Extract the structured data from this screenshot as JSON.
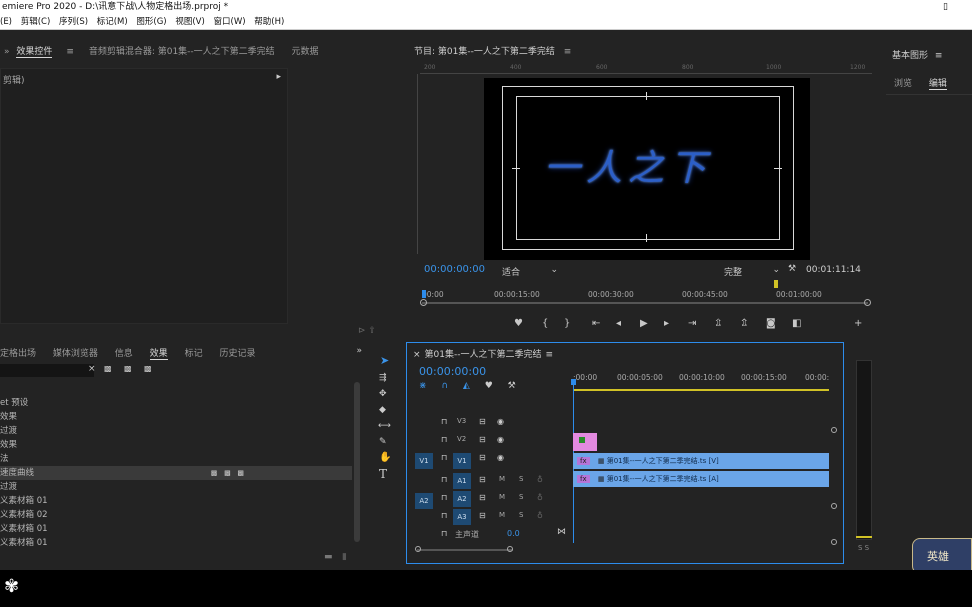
{
  "window": {
    "title": "emiere Pro 2020 - D:\\讯意下战\\人物定格出场.prproj *"
  },
  "menu": [
    "(E)",
    "剪辑(C)",
    "序列(S)",
    "标记(M)",
    "图形(G)",
    "视图(V)",
    "窗口(W)",
    "帮助(H)"
  ],
  "effect_controls": {
    "tabs": [
      "效果控件",
      "音频剪辑混合器: 第01集--一人之下第二季完结",
      "元数据"
    ],
    "subheader": "剪辑)",
    "menu_glyph": "≡"
  },
  "program_monitor": {
    "tab": "节目: 第01集--一人之下第二季完结",
    "ruler": [
      "200",
      "400",
      "600",
      "800",
      "1000",
      "1200"
    ],
    "timecode": "00:00:00:00",
    "fit": "适合",
    "quality": "完整",
    "duration": "00:01:11:14",
    "scrub_ticks": [
      "00:00",
      "00:00:15:00",
      "00:00:30:00",
      "00:00:45:00",
      "00:01:00:00"
    ],
    "calligraphy": "一人之下"
  },
  "essential_graphics": {
    "title": "基本图形",
    "tabs": [
      "浏览",
      "编辑"
    ]
  },
  "project": {
    "tabs": [
      "定格出场",
      "媒体浏览器",
      "信息",
      "效果",
      "标记",
      "历史记录"
    ],
    "more": "»",
    "items": [
      "et 预设",
      "效果",
      "过渡",
      "效果",
      "法",
      "速度曲线",
      "过渡",
      "义素材箱 01",
      "义素材箱 02",
      "义素材箱 01",
      "义素材箱 01"
    ]
  },
  "timeline": {
    "tab": "第01集--一人之下第二季完结",
    "timecode": "00:00:00:00",
    "ruler": [
      ":00:00",
      "00:00:05:00",
      "00:00:10:00",
      "00:00:15:00",
      "00:00:"
    ],
    "video_tracks": [
      "V3",
      "V2",
      "V1"
    ],
    "audio_tracks": [
      "A1",
      "A2",
      "A3"
    ],
    "source_v": "V1",
    "source_a": "A2",
    "master_label": "主声道",
    "master_value": "0.0",
    "v1_clip": "第01集--一人之下第二季完结.ts [V]",
    "a1_clip": "第01集--一人之下第二季完结.ts [A]",
    "fx_label": "fx",
    "m_label": "M",
    "s_label": "S"
  },
  "meter": {
    "label": "S S"
  },
  "overlay": {
    "badge": "英雄"
  },
  "colors": {
    "accent": "#2d8ceb",
    "clip": "#6aa5e8",
    "marker": "#e38ae0",
    "timeline_bar": "#d1c226"
  }
}
